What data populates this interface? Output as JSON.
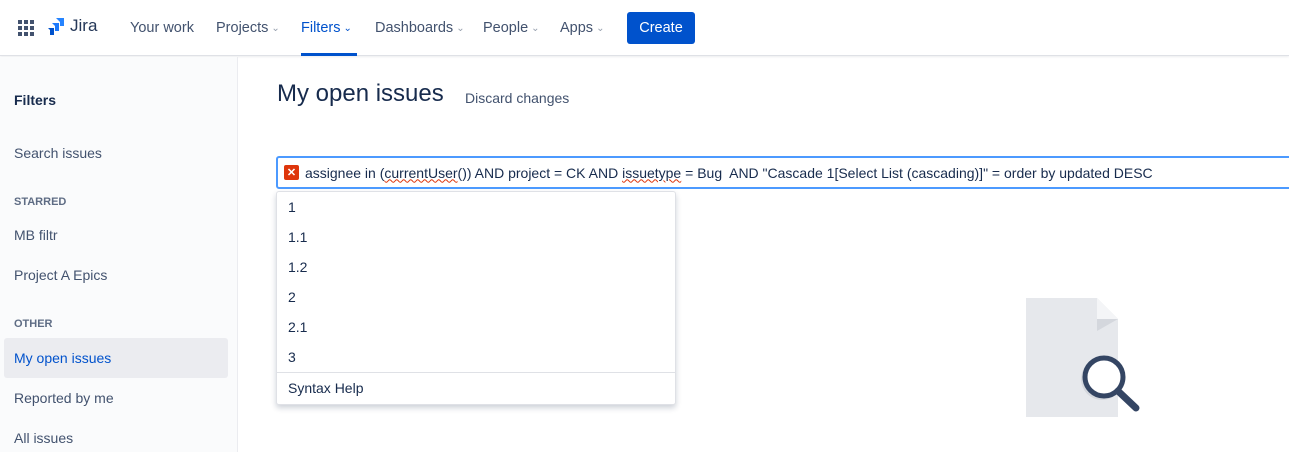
{
  "nav": {
    "logo": "Jira",
    "items": [
      {
        "label": "Your work",
        "chev": false
      },
      {
        "label": "Projects",
        "chev": true
      },
      {
        "label": "Filters",
        "chev": true
      },
      {
        "label": "Dashboards",
        "chev": true
      },
      {
        "label": "People",
        "chev": true
      },
      {
        "label": "Apps",
        "chev": true
      }
    ],
    "create": "Create"
  },
  "sidebar": {
    "title": "Filters",
    "search": "Search issues",
    "starred": "STARRED",
    "starred_items": [
      "MB filtr",
      "Project A Epics"
    ],
    "other": "OTHER",
    "other_items": [
      "My open issues",
      "Reported by me",
      "All issues"
    ]
  },
  "main": {
    "title": "My open issues",
    "discard": "Discard changes",
    "jql": {
      "p1": "assignee in (",
      "p2": "currentUser",
      "p3": "()) AND project = CK AND ",
      "p4": "issuetype",
      "p5": " = Bug  AND \"Cascade 1[Select List (cascading)]\" = order by updated DESC"
    },
    "suggestions": [
      "1",
      "1.1",
      "1.2",
      "2",
      "2.1",
      "3"
    ],
    "syntax_help": "Syntax Help"
  }
}
